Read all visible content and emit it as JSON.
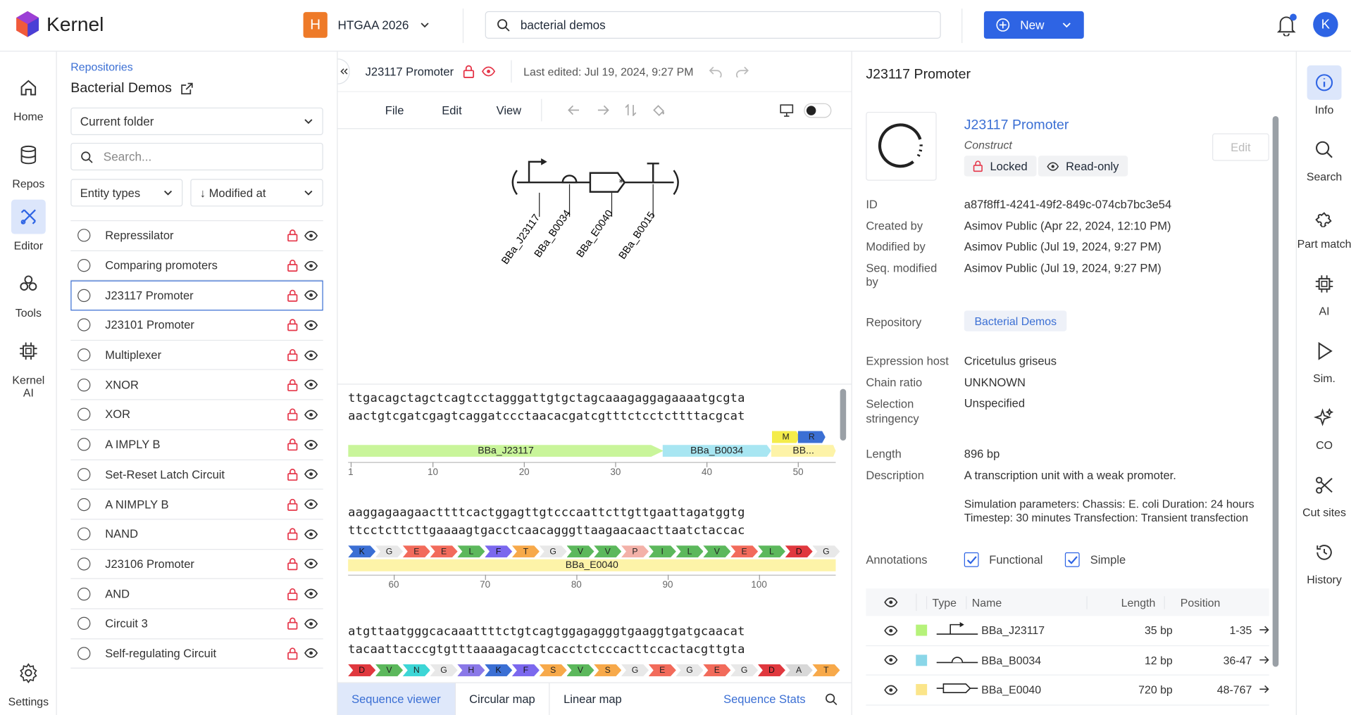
{
  "app": {
    "name": "Kernel"
  },
  "workspace": {
    "badge": "H",
    "name": "HTGAA 2026"
  },
  "search": {
    "value": "bacterial demos"
  },
  "header": {
    "new_label": "New",
    "avatar": "K"
  },
  "left_nav": [
    {
      "label": "Home",
      "icon": "home-icon"
    },
    {
      "label": "Repos",
      "icon": "database-icon"
    },
    {
      "label": "Editor",
      "icon": "editor-icon"
    },
    {
      "label": "Tools",
      "icon": "tools-icon"
    },
    {
      "label": "Kernel AI",
      "icon": "chip-icon"
    },
    {
      "label": "Settings",
      "icon": "gear-icon"
    }
  ],
  "panel": {
    "breadcrumb": "Repositories",
    "title": "Bacterial Demos",
    "folder": "Current folder",
    "search_placeholder": "Search...",
    "entity_types": "Entity types",
    "sort": "↓ Modified at",
    "items": [
      "Repressilator",
      "Comparing promoters",
      "J23117 Promoter",
      "J23101 Promoter",
      "Multiplexer",
      "XNOR",
      "XOR",
      "A IMPLY B",
      "Set-Reset Latch Circuit",
      "A NIMPLY B",
      "NAND",
      "J23106 Promoter",
      "AND",
      "Circuit 3",
      "Self-regulating Circuit"
    ]
  },
  "editor": {
    "title": "J23117 Promoter",
    "last_edited": "Last edited: Jul 19, 2024, 9:27 PM",
    "menu": [
      "File",
      "Edit",
      "View"
    ],
    "glyph_labels": [
      "BBa_J23117",
      "BBa_B0034",
      "BBa_E0040",
      "BBa_B0015"
    ],
    "blocks": [
      {
        "top": "ttgacagctagctcagtcctagggattgtgctagcaaagaggagaaaatgcgta",
        "bottom": "aactgtcgatcgagtcaggatccctaacacgatcgtttctcctcttttacgcat",
        "ticks": [
          "1",
          "10",
          "20",
          "30",
          "40",
          "50"
        ],
        "features": [
          "BBa_J23117",
          "BBa_B0034",
          "BB..."
        ],
        "aa": [
          "M",
          "R"
        ]
      },
      {
        "top": "aaggagaagaacttttcactggagttgtcccaattcttgttgaattagatggtg",
        "bottom": "ttcctcttcttgaaaagtgacctcaacagggttaagaacaacttaatctaccac",
        "ticks": [
          "60",
          "70",
          "80",
          "90",
          "100"
        ],
        "features": [
          "BBa_E0040"
        ],
        "aa": [
          "K",
          "G",
          "E",
          "E",
          "L",
          "F",
          "T",
          "G",
          "V",
          "V",
          "P",
          "I",
          "L",
          "V",
          "E",
          "L",
          "D",
          "G"
        ]
      },
      {
        "top": "atgttaatgggcacaaattttctgtcagtggagagggtgaaggtgatgcaacat",
        "bottom": "tacaattacccgtgtttaaaagacagtcacctctcccacttccactacgttgta",
        "ticks": [],
        "features": [],
        "aa": [
          "D",
          "V",
          "N",
          "G",
          "H",
          "K",
          "F",
          "S",
          "V",
          "S",
          "G",
          "E",
          "G",
          "E",
          "G",
          "D",
          "A",
          "T"
        ]
      }
    ],
    "tabs": [
      "Sequence viewer",
      "Circular map",
      "Linear map"
    ],
    "stats": "Sequence Stats"
  },
  "info": {
    "heading": "J23117 Promoter",
    "name": "J23117 Promoter",
    "type": "Construct",
    "locked": "Locked",
    "readonly": "Read-only",
    "edit": "Edit",
    "fields": [
      {
        "k": "ID",
        "v": "a87f8ff1-4241-49f2-849c-074cb7bc3e54"
      },
      {
        "k": "Created by",
        "v": "Asimov Public (Apr 22, 2024, 12:10 PM)"
      },
      {
        "k": "Modified by",
        "v": "Asimov Public (Jul 19, 2024, 9:27 PM)"
      },
      {
        "k": "Seq. modified by",
        "v": "Asimov Public (Jul 19, 2024, 9:27 PM)"
      }
    ],
    "repository_label": "Repository",
    "repository": "Bacterial Demos",
    "host_label": "Expression host",
    "host": "Cricetulus griseus",
    "chain_label": "Chain ratio",
    "chain": "UNKNOWN",
    "strin_label": "Selection stringency",
    "strin": "Unspecified",
    "length_label": "Length",
    "length": "896 bp",
    "desc_label": "Description",
    "desc": "A transcription unit with a weak promoter.",
    "desc2": "Simulation parameters: Chassis: E. coli Duration: 24 hours Timestep: 30 minutes Transfection: Transient transfection",
    "ann_label": "Annotations",
    "ann_functional": "Functional",
    "ann_simple": "Simple",
    "table_headers": [
      "Type",
      "Name",
      "Length",
      "Position"
    ],
    "rows": [
      {
        "name": "BBa_J23117",
        "length": "35 bp",
        "pos": "1-35",
        "color": "#b6f27a"
      },
      {
        "name": "BBa_B0034",
        "length": "12 bp",
        "pos": "36-47",
        "color": "#8ad6e8"
      },
      {
        "name": "BBa_E0040",
        "length": "720 bp",
        "pos": "48-767",
        "color": "#fbe58a"
      }
    ]
  },
  "right_nav": [
    {
      "label": "Info",
      "icon": "info-icon"
    },
    {
      "label": "Search",
      "icon": "search-icon"
    },
    {
      "label": "Part match",
      "icon": "puzzle-icon"
    },
    {
      "label": "AI",
      "icon": "chip-icon"
    },
    {
      "label": "Sim.",
      "icon": "play-icon"
    },
    {
      "label": "CO",
      "icon": "sparkle-icon"
    },
    {
      "label": "Cut sites",
      "icon": "scissors-icon"
    },
    {
      "label": "History",
      "icon": "history-icon"
    }
  ]
}
